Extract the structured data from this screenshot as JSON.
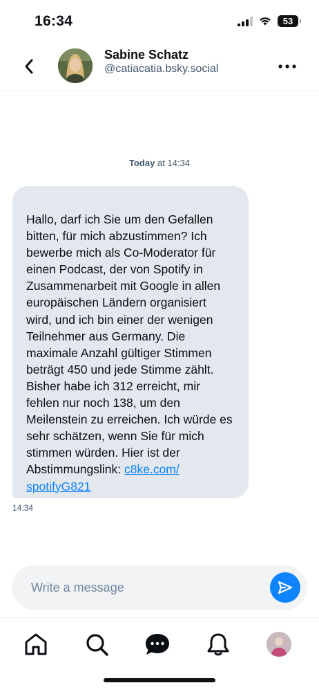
{
  "status_bar": {
    "time": "16:34",
    "battery": "53"
  },
  "header": {
    "name": "Sabine Schatz",
    "handle": "@catiacatia.bsky.social"
  },
  "date_divider": {
    "day": "Today",
    "time": "at 14:34"
  },
  "message": {
    "text": "Hallo, darf ich Sie um den Gefallen bitten, für mich abzustimmen? Ich bewerbe mich als Co-Moderator für einen Podcast, der von Spotify in Zusammenarbeit mit Google in allen europäischen Ländern organisiert wird, und ich bin einer der wenigen Teilnehmer aus Germany. Die maximale Anzahl gültiger Stimmen beträgt 450 und jede Stimme zählt. Bisher habe ich 312 erreicht, mir fehlen nur noch 138, um den Meilenstein zu erreichen. Ich würde es sehr schätzen, wenn Sie für mich stimmen würden. Hier ist der Abstimmungslink: ",
    "link_line1": "c8ke.com/",
    "link_line2": "spotifyG821",
    "timestamp": "14:34"
  },
  "composer": {
    "placeholder": "Write a message"
  },
  "colors": {
    "accent": "#1083fe",
    "bubble": "#e3e8ee",
    "muted_text": "#42576c"
  },
  "tab_bar": {
    "items": [
      "home-icon",
      "search-icon",
      "chat-icon",
      "bell-icon",
      "profile-avatar"
    ]
  }
}
